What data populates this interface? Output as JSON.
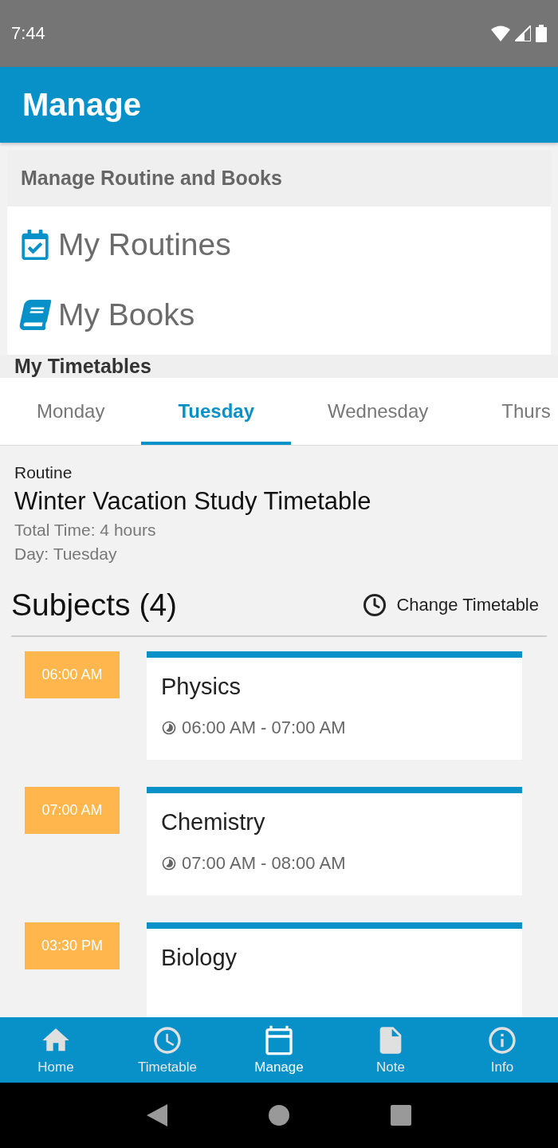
{
  "status_bar": {
    "time": "7:44"
  },
  "app_bar": {
    "title": "Manage"
  },
  "manage_section": {
    "title": "Manage Routine and Books",
    "items": [
      {
        "label": "My Routines"
      },
      {
        "label": "My Books"
      }
    ]
  },
  "timetables": {
    "title": "My Timetables",
    "tabs": [
      {
        "label": "Monday",
        "selected": false
      },
      {
        "label": "Tuesday",
        "selected": true
      },
      {
        "label": "Wednesday",
        "selected": false
      },
      {
        "label": "Thurs",
        "selected": false
      }
    ]
  },
  "routine": {
    "caption": "Routine",
    "name": "Winter Vacation Study Timetable",
    "total_time": "Total Time: 4 hours",
    "day": "Day: Tuesday"
  },
  "subjects": {
    "title": "Subjects (4)",
    "action": "Change Timetable",
    "items": [
      {
        "time": "06:00 AM",
        "name": "Physics",
        "range": "06:00 AM - 07:00 AM"
      },
      {
        "time": "07:00 AM",
        "name": "Chemistry",
        "range": "07:00 AM - 08:00 AM"
      },
      {
        "time": "03:30 PM",
        "name": "Biology"
      }
    ]
  },
  "bottom_nav": [
    {
      "label": "Home",
      "selected": false
    },
    {
      "label": "Timetable",
      "selected": false
    },
    {
      "label": "Manage",
      "selected": true
    },
    {
      "label": "Note",
      "selected": false
    },
    {
      "label": "Info",
      "selected": false
    }
  ]
}
